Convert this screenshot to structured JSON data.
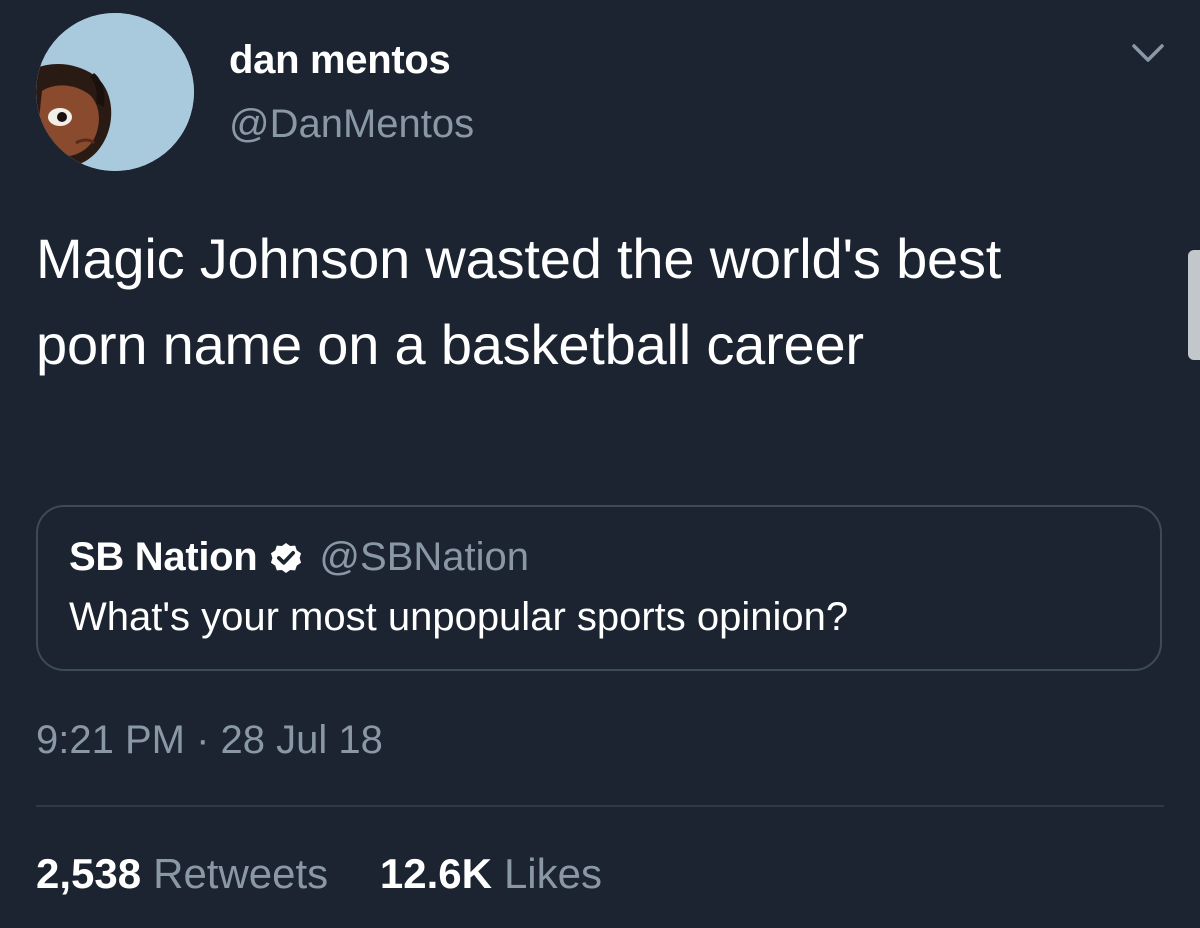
{
  "tweet": {
    "author": {
      "display_name": "dan mentos",
      "handle": "@DanMentos"
    },
    "text": "Magic Johnson wasted the world's best porn name on a basketball career",
    "quoted": {
      "display_name": "SB Nation",
      "verified": true,
      "handle": "@SBNation",
      "text": "What's your most unpopular sports opinion?"
    },
    "timestamp": "9:21 PM · 28 Jul 18",
    "stats": {
      "retweets_count": "2,538",
      "retweets_label": "Retweets",
      "likes_count": "12.6K",
      "likes_label": "Likes"
    }
  },
  "icons": {
    "menu": "chevron-down-icon",
    "verified": "verified-badge-icon"
  },
  "colors": {
    "background": "#1b2430",
    "primary_text": "#ffffff",
    "secondary_text": "#8a98a6",
    "border": "#3d4a58"
  }
}
